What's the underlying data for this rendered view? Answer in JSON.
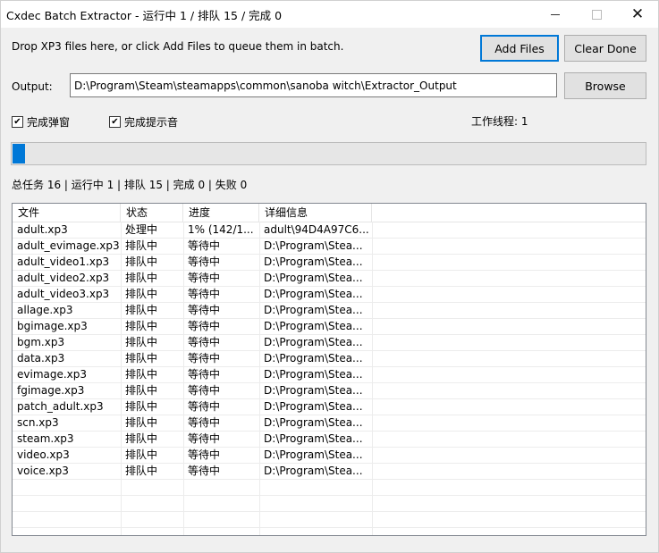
{
  "window": {
    "title": "Cxdec Batch Extractor - 运行中 1 / 排队 15 / 完成 0",
    "minimize_glyph": "—",
    "close_glyph": "✕"
  },
  "drop_hint": "Drop XP3 files here, or click Add Files to queue them in batch.",
  "buttons": {
    "add_files": "Add Files",
    "clear_done": "Clear Done",
    "browse": "Browse"
  },
  "output": {
    "label": "Output:",
    "value": "D:\\Program\\Steam\\steamapps\\common\\sanoba witch\\Extractor_Output"
  },
  "options": {
    "popup_label": "完成弹窗",
    "popup_checked": true,
    "sound_label": "完成提示音",
    "sound_checked": true,
    "check_glyph": "✔"
  },
  "threads_label": "工作线程: 1",
  "progress": {
    "fraction": 0.02
  },
  "summary": "总任务 16 | 运行中 1 | 排队 15 | 完成 0 | 失败 0",
  "table": {
    "headers": [
      "文件",
      "状态",
      "进度",
      "详细信息"
    ],
    "rows": [
      {
        "file": "adult.xp3",
        "state": "处理中",
        "progress": "1% (142/1...",
        "detail": "adult\\94D4A97C6..."
      },
      {
        "file": "adult_evimage.xp3",
        "state": "排队中",
        "progress": "等待中",
        "detail": "D:\\Program\\Stea..."
      },
      {
        "file": "adult_video1.xp3",
        "state": "排队中",
        "progress": "等待中",
        "detail": "D:\\Program\\Stea..."
      },
      {
        "file": "adult_video2.xp3",
        "state": "排队中",
        "progress": "等待中",
        "detail": "D:\\Program\\Stea..."
      },
      {
        "file": "adult_video3.xp3",
        "state": "排队中",
        "progress": "等待中",
        "detail": "D:\\Program\\Stea..."
      },
      {
        "file": "allage.xp3",
        "state": "排队中",
        "progress": "等待中",
        "detail": "D:\\Program\\Stea..."
      },
      {
        "file": "bgimage.xp3",
        "state": "排队中",
        "progress": "等待中",
        "detail": "D:\\Program\\Stea..."
      },
      {
        "file": "bgm.xp3",
        "state": "排队中",
        "progress": "等待中",
        "detail": "D:\\Program\\Stea..."
      },
      {
        "file": "data.xp3",
        "state": "排队中",
        "progress": "等待中",
        "detail": "D:\\Program\\Stea..."
      },
      {
        "file": "evimage.xp3",
        "state": "排队中",
        "progress": "等待中",
        "detail": "D:\\Program\\Stea..."
      },
      {
        "file": "fgimage.xp3",
        "state": "排队中",
        "progress": "等待中",
        "detail": "D:\\Program\\Stea..."
      },
      {
        "file": "patch_adult.xp3",
        "state": "排队中",
        "progress": "等待中",
        "detail": "D:\\Program\\Stea..."
      },
      {
        "file": "scn.xp3",
        "state": "排队中",
        "progress": "等待中",
        "detail": "D:\\Program\\Stea..."
      },
      {
        "file": "steam.xp3",
        "state": "排队中",
        "progress": "等待中",
        "detail": "D:\\Program\\Stea..."
      },
      {
        "file": "video.xp3",
        "state": "排队中",
        "progress": "等待中",
        "detail": "D:\\Program\\Stea..."
      },
      {
        "file": "voice.xp3",
        "state": "排队中",
        "progress": "等待中",
        "detail": "D:\\Program\\Stea..."
      }
    ]
  }
}
